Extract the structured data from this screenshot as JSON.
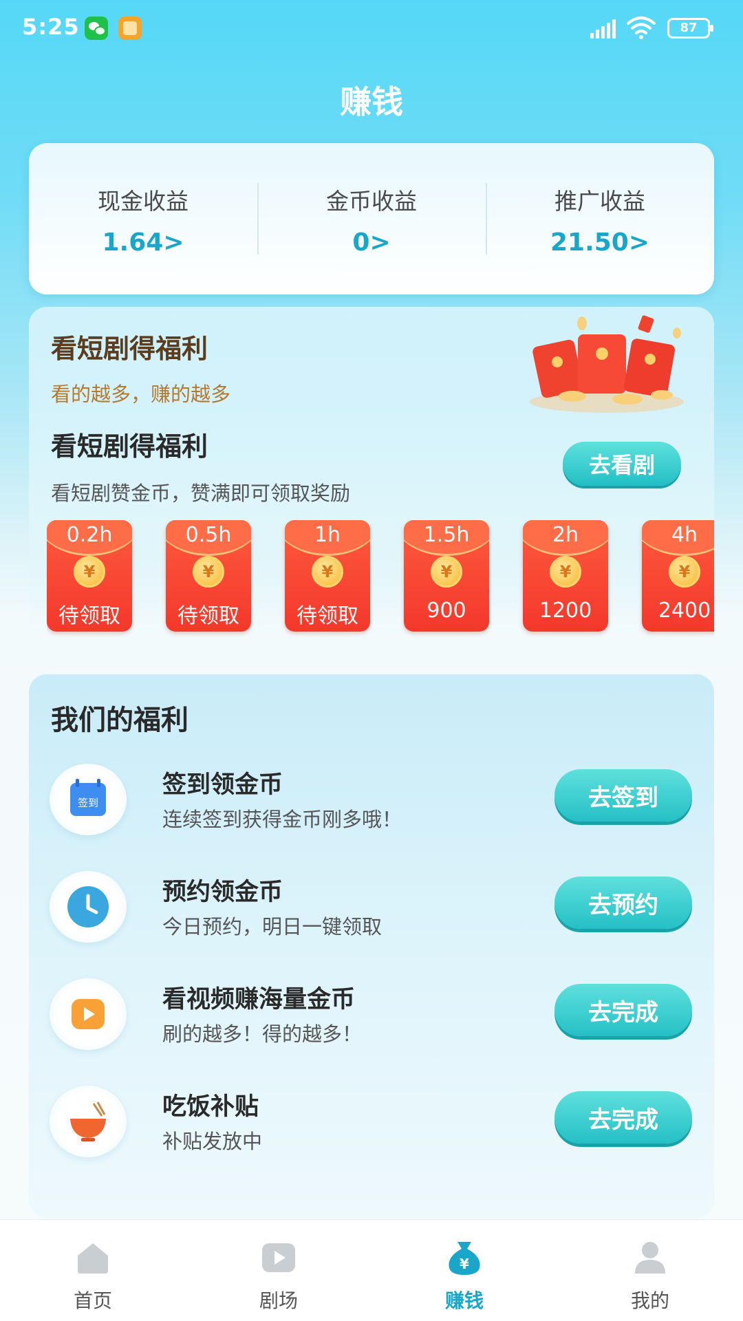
{
  "status_bar": {
    "time": "5:25",
    "battery": "87"
  },
  "header": {
    "title": "赚钱"
  },
  "earnings": [
    {
      "label": "现金收益",
      "value": "1.64>"
    },
    {
      "label": "金币收益",
      "value": "0>"
    },
    {
      "label": "推广收益",
      "value": "21.50>"
    }
  ],
  "drama": {
    "title": "看短剧得福利",
    "subtitle": "看的越多，赚的越多",
    "task_title": "看短剧得福利",
    "task_desc": "看短剧赞金币，赞满即可领取奖励",
    "button": "去看剧",
    "packets": [
      {
        "duration": "0.2h",
        "status": "待领取"
      },
      {
        "duration": "0.5h",
        "status": "待领取"
      },
      {
        "duration": "1h",
        "status": "待领取"
      },
      {
        "duration": "1.5h",
        "status": "900"
      },
      {
        "duration": "2h",
        "status": "1200"
      },
      {
        "duration": "4h",
        "status": "2400"
      }
    ],
    "coin_symbol": "¥"
  },
  "benefits": {
    "title": "我们的福利",
    "items": [
      {
        "name": "签到领金币",
        "desc": "连续签到获得金币刚多哦！",
        "button": "去签到",
        "icon": "calendar-icon",
        "icon_text": "签到"
      },
      {
        "name": "预约领金币",
        "desc": "今日预约，明日一键领取",
        "button": "去预约",
        "icon": "clock-icon"
      },
      {
        "name": "看视频赚海量金币",
        "desc": "刷的越多！得的越多！",
        "button": "去完成",
        "icon": "play-icon"
      },
      {
        "name": "吃饭补贴",
        "desc": "补贴发放中",
        "button": "去完成",
        "icon": "bowl-icon"
      }
    ]
  },
  "tabs": [
    {
      "label": "首页",
      "icon": "home-icon",
      "active": false
    },
    {
      "label": "剧场",
      "icon": "play-icon",
      "active": false
    },
    {
      "label": "赚钱",
      "icon": "money-bag-icon",
      "active": true
    },
    {
      "label": "我的",
      "icon": "user-icon",
      "active": false
    }
  ],
  "colors": {
    "accent": "#1aa6c8",
    "button_teal": "#24c0c6",
    "packet_red": "#f3382c",
    "inactive_tab": "#c9ced2"
  }
}
